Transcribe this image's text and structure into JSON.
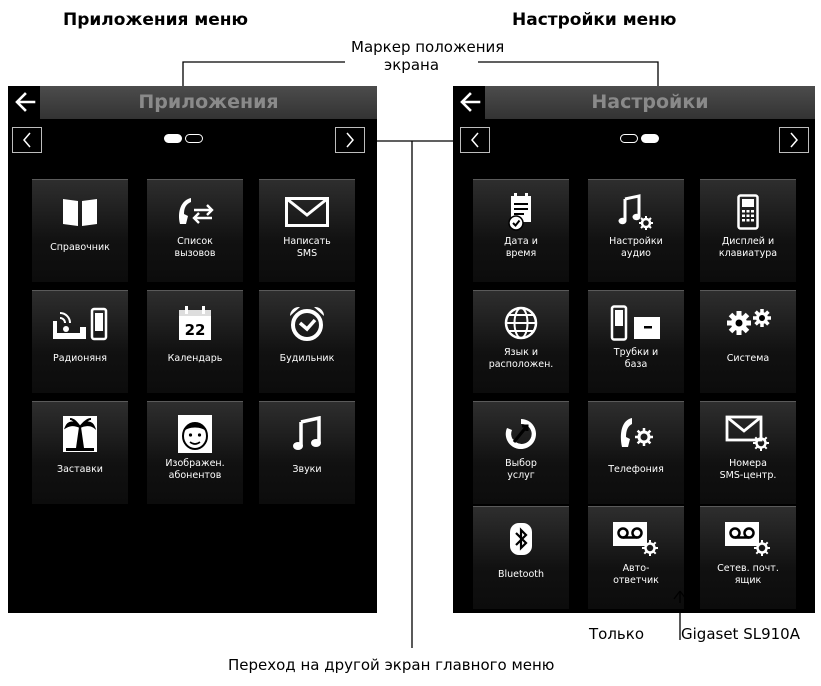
{
  "headings": {
    "left": "Приложения меню",
    "right": "Настройки меню"
  },
  "callouts": {
    "marker_line1": "Маркер положения",
    "marker_line2": "экрана",
    "only": "Только",
    "model": "Gigaset SL910A",
    "transition": "Переход на другой экран главного меню"
  },
  "left_screen": {
    "title": "Приложения",
    "page_indicator": {
      "current": 1,
      "total": 2
    },
    "tiles": [
      {
        "label1": "Справочник",
        "label2": "",
        "icon": "book-icon"
      },
      {
        "label1": "Список",
        "label2": "вызовов",
        "icon": "call-list-icon"
      },
      {
        "label1": "Написать",
        "label2": "SMS",
        "icon": "envelope-icon"
      },
      {
        "label1": "Радионяня",
        "label2": "",
        "icon": "baby-monitor-icon"
      },
      {
        "label1": "Календарь",
        "label2": "",
        "icon": "calendar-icon"
      },
      {
        "label1": "Будильник",
        "label2": "",
        "icon": "alarm-clock-icon"
      },
      {
        "label1": "Заставки",
        "label2": "",
        "icon": "palm-tree-icon"
      },
      {
        "label1": "Изображен.",
        "label2": "абонентов",
        "icon": "face-icon"
      },
      {
        "label1": "Звуки",
        "label2": "",
        "icon": "music-note-icon"
      }
    ],
    "calendar_day": "22"
  },
  "right_screen": {
    "title": "Настройки",
    "page_indicator": {
      "current": 2,
      "total": 2
    },
    "tiles": [
      {
        "label1": "Дата и",
        "label2": "время",
        "icon": "date-time-icon"
      },
      {
        "label1": "Настройки",
        "label2": "аудио",
        "icon": "audio-settings-icon"
      },
      {
        "label1": "Дисплей и",
        "label2": "клавиатура",
        "icon": "handset-display-icon"
      },
      {
        "label1": "Язык и",
        "label2": "расположен.",
        "icon": "globe-icon"
      },
      {
        "label1": "Трубки и",
        "label2": "база",
        "icon": "handset-base-icon"
      },
      {
        "label1": "Система",
        "label2": "",
        "icon": "gears-icon"
      },
      {
        "label1": "Выбор",
        "label2": "услуг",
        "icon": "service-select-icon"
      },
      {
        "label1": "Телефония",
        "label2": "",
        "icon": "telephony-icon"
      },
      {
        "label1": "Номера",
        "label2": "SMS-центр.",
        "icon": "sms-center-icon"
      },
      {
        "label1": "Bluetooth",
        "label2": "",
        "icon": "bluetooth-icon"
      },
      {
        "label1": "Авто-",
        "label2": "ответчик",
        "icon": "answering-machine-icon"
      },
      {
        "label1": "Сетев. почт.",
        "label2": "ящик",
        "icon": "voicemail-icon"
      }
    ]
  }
}
